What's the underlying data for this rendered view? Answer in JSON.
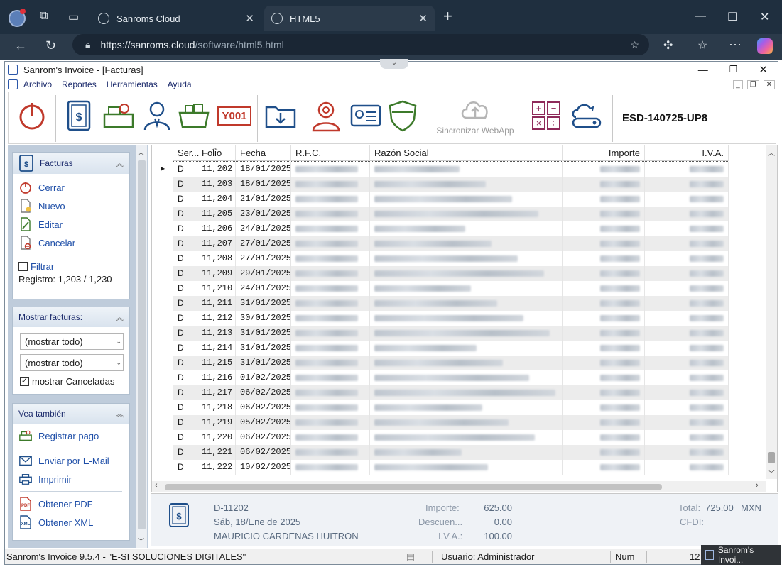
{
  "browser": {
    "tabs": [
      {
        "label": "Sanroms Cloud",
        "active": false
      },
      {
        "label": "HTML5",
        "active": true
      }
    ],
    "url_host": "https://sanroms.cloud",
    "url_path": "/software/html5.html"
  },
  "app": {
    "title": "Sanrom's Invoice - [Facturas]",
    "menu": [
      "Archivo",
      "Reportes",
      "Herramientas",
      "Ayuda"
    ],
    "toolbar": {
      "sync_label": "Sincronizar WebApp",
      "license_code": "ESD-140725-UP8",
      "folio_icon_text": "Y001"
    }
  },
  "sidebar": {
    "facturas_panel": {
      "title": "Facturas",
      "links": [
        "Cerrar",
        "Nuevo",
        "Editar",
        "Cancelar"
      ],
      "filter_label": "Filtrar",
      "registro": "Registro: 1,203 / 1,230"
    },
    "mostrar_panel": {
      "title": "Mostrar facturas:",
      "select1": "(mostrar todo)",
      "select2": "(mostrar todo)",
      "canceladas_label": "mostrar Canceladas"
    },
    "vea_panel": {
      "title": "Vea también",
      "links": [
        "Registrar pago",
        "Enviar por E-Mail",
        "Imprimir",
        "Obtener PDF",
        "Obtener XML"
      ]
    }
  },
  "grid": {
    "columns": [
      "Ser...",
      "Folio",
      "Fecha",
      "R.F.C.",
      "Razón Social",
      "Importe",
      "I.V.A."
    ],
    "rows": [
      {
        "serie": "D",
        "folio": "11,202",
        "fecha": "18/01/2025"
      },
      {
        "serie": "D",
        "folio": "11,203",
        "fecha": "18/01/2025"
      },
      {
        "serie": "D",
        "folio": "11,204",
        "fecha": "21/01/2025"
      },
      {
        "serie": "D",
        "folio": "11,205",
        "fecha": "23/01/2025"
      },
      {
        "serie": "D",
        "folio": "11,206",
        "fecha": "24/01/2025"
      },
      {
        "serie": "D",
        "folio": "11,207",
        "fecha": "27/01/2025"
      },
      {
        "serie": "D",
        "folio": "11,208",
        "fecha": "27/01/2025"
      },
      {
        "serie": "D",
        "folio": "11,209",
        "fecha": "29/01/2025"
      },
      {
        "serie": "D",
        "folio": "11,210",
        "fecha": "24/01/2025"
      },
      {
        "serie": "D",
        "folio": "11,211",
        "fecha": "31/01/2025"
      },
      {
        "serie": "D",
        "folio": "11,212",
        "fecha": "30/01/2025"
      },
      {
        "serie": "D",
        "folio": "11,213",
        "fecha": "31/01/2025"
      },
      {
        "serie": "D",
        "folio": "11,214",
        "fecha": "31/01/2025"
      },
      {
        "serie": "D",
        "folio": "11,215",
        "fecha": "31/01/2025"
      },
      {
        "serie": "D",
        "folio": "11,216",
        "fecha": "01/02/2025"
      },
      {
        "serie": "D",
        "folio": "11,217",
        "fecha": "06/02/2025"
      },
      {
        "serie": "D",
        "folio": "11,218",
        "fecha": "06/02/2025"
      },
      {
        "serie": "D",
        "folio": "11,219",
        "fecha": "05/02/2025"
      },
      {
        "serie": "D",
        "folio": "11,220",
        "fecha": "06/02/2025"
      },
      {
        "serie": "D",
        "folio": "11,221",
        "fecha": "06/02/2025"
      },
      {
        "serie": "D",
        "folio": "11,222",
        "fecha": "10/02/2025"
      }
    ]
  },
  "detail": {
    "folio": "D-11202",
    "fecha": "Sáb, 18/Ene de 2025",
    "cliente": "MAURICIO CARDENAS HUITRON",
    "importe_label": "Importe:",
    "importe": "625.00",
    "descuento_label": "Descuen...",
    "descuento": "0.00",
    "iva_label": "I.V.A.:",
    "iva": "100.00",
    "total_label": "Total:",
    "total": "725.00",
    "currency": "MXN",
    "cfdi_label": "CFDI:"
  },
  "status": {
    "app_version": "Sanrom's Invoice  9.5.4 - \"E-SI SOLUCIONES DIGITALES\"",
    "usuario": "Usuario: Administrador",
    "num": "Num",
    "tail": "12"
  },
  "taskbar_popup": "Sanrom's Invoi..."
}
